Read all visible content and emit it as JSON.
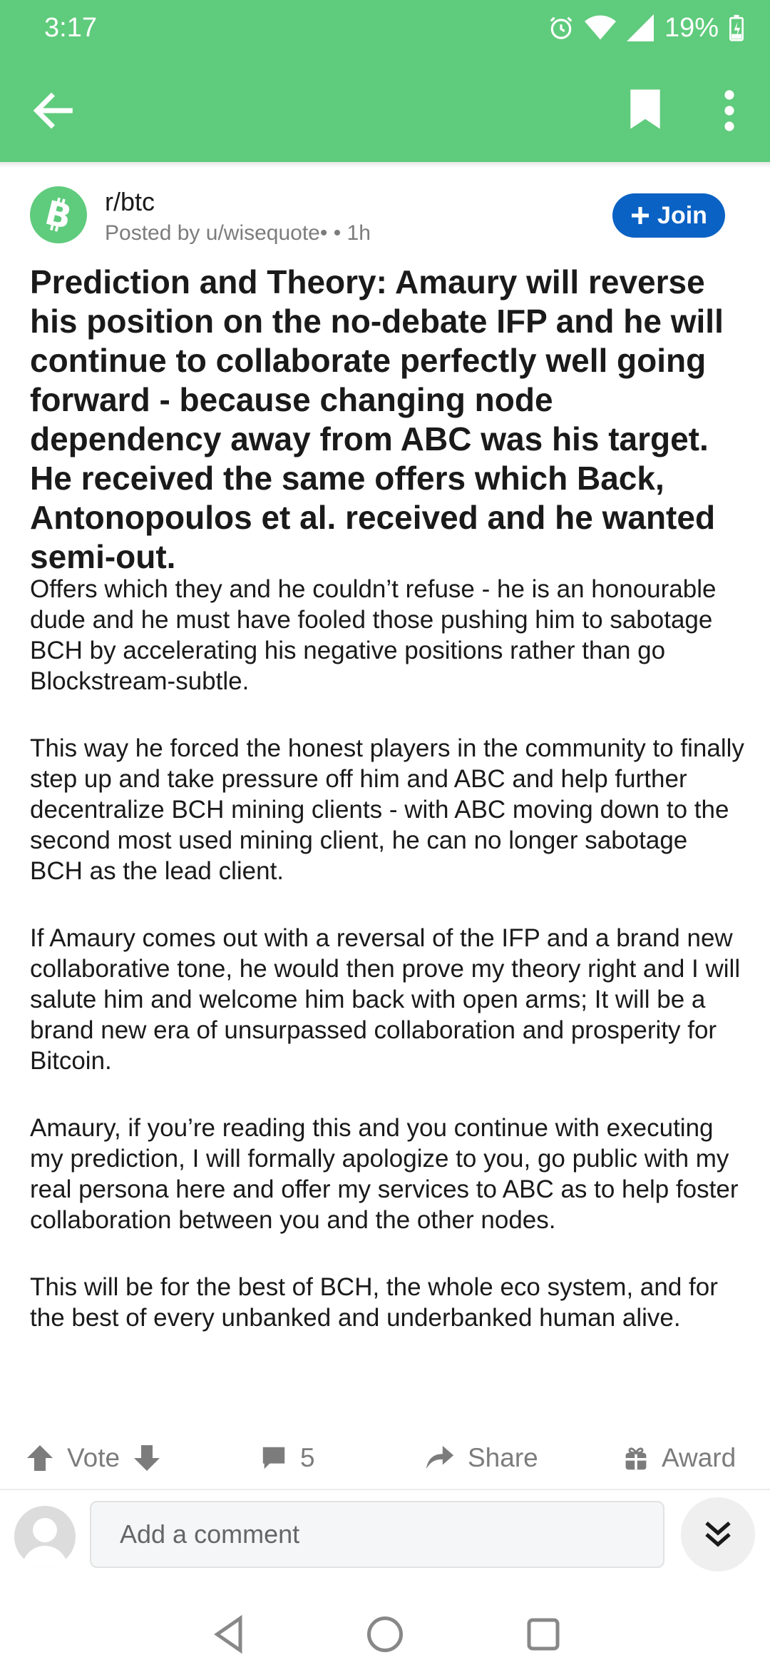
{
  "status_bar": {
    "time": "3:17",
    "battery": "19%"
  },
  "colors": {
    "header": "#5fcb7c",
    "join_button": "#0a62c4",
    "text": "#1a1a1b",
    "muted": "#7c7c7c"
  },
  "post": {
    "subreddit": "r/btc",
    "posted_by": "Posted by u/wisequote•  • 1h",
    "join_label": "Join",
    "title": "Prediction and Theory: Amaury will reverse his position on the no-debate IFP and he will continue to collaborate perfectly well going forward - because changing node dependency away from ABC was his target. He received the same offers which Back, Antonopoulos et al. received and he wanted semi-out.",
    "paragraphs": [
      "Offers which they and he couldn’t refuse - he is an honourable dude and he must have fooled those pushing him to sabotage BCH by accelerating his negative positions rather than go Blockstream-subtle.",
      "This way he forced the honest players in the community to finally step up and take pressure off him and ABC and help further decentralize BCH mining clients - with ABC moving down to the second most used mining client, he can no longer sabotage BCH as the lead client.",
      "If Amaury comes out with a reversal of the IFP and a brand new collaborative tone, he would then prove my theory right and I will salute him and welcome him back with open arms; It will be a brand new era of unsurpassed collaboration and prosperity for Bitcoin.",
      "Amaury, if you’re reading this and you continue with executing my prediction, I will formally apologize to you, go public with my real persona here and offer my services to ABC as to help foster collaboration between you and the other nodes.",
      "This will be for the best of BCH, the whole eco system, and for the best of every unbanked and underbanked human alive."
    ]
  },
  "actions": {
    "vote_label": "Vote",
    "comments_count": "5",
    "share_label": "Share",
    "award_label": "Award"
  },
  "comment_bar": {
    "placeholder": "Add a comment"
  },
  "icons": {
    "back": "arrow-left-icon",
    "bookmark": "bookmark-icon",
    "menu": "more-vertical-icon",
    "subreddit": "bitcoin-icon",
    "upvote": "arrow-up-icon",
    "downvote": "arrow-down-icon",
    "comments": "comment-icon",
    "share": "share-icon",
    "award": "gift-icon",
    "collapse": "double-chevron-down-icon",
    "nav_back": "triangle-back-icon",
    "nav_home": "circle-home-icon",
    "nav_recents": "square-recents-icon"
  }
}
